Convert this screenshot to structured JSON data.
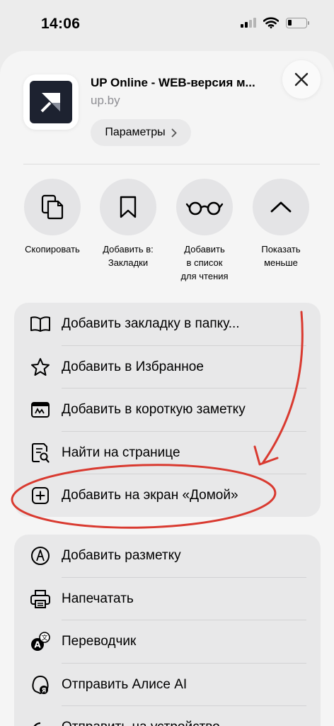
{
  "status_bar": {
    "time": "14:06"
  },
  "header": {
    "title": "UP Online - WEB-версия м...",
    "url": "up.by",
    "options_label": "Параметры"
  },
  "actions": [
    {
      "label": "Скопировать",
      "icon": "copy-icon"
    },
    {
      "label": "Добавить в: Закладки",
      "icon": "bookmark-icon"
    },
    {
      "label": "Добавить в список для чтения",
      "icon": "glasses-icon"
    },
    {
      "label": "Показать меньше",
      "icon": "chevron-up-icon"
    }
  ],
  "group1": [
    {
      "label": "Добавить закладку в папку...",
      "icon": "book-icon"
    },
    {
      "label": "Добавить в Избранное",
      "icon": "star-icon"
    },
    {
      "label": "Добавить в короткую заметку",
      "icon": "quick-note-icon"
    },
    {
      "label": "Найти на странице",
      "icon": "find-on-page-icon"
    },
    {
      "label": "Добавить на экран «Домой»",
      "icon": "add-square-icon"
    }
  ],
  "group2": [
    {
      "label": "Добавить разметку",
      "icon": "markup-icon"
    },
    {
      "label": "Напечатать",
      "icon": "printer-icon"
    },
    {
      "label": "Переводчик",
      "icon": "translate-icon"
    },
    {
      "label": "Отправить Алисе AI",
      "icon": "alice-icon"
    },
    {
      "label": "Отправить на устройство",
      "icon": "send-to-device-icon"
    }
  ],
  "annotation": {
    "color": "#d93a30"
  }
}
